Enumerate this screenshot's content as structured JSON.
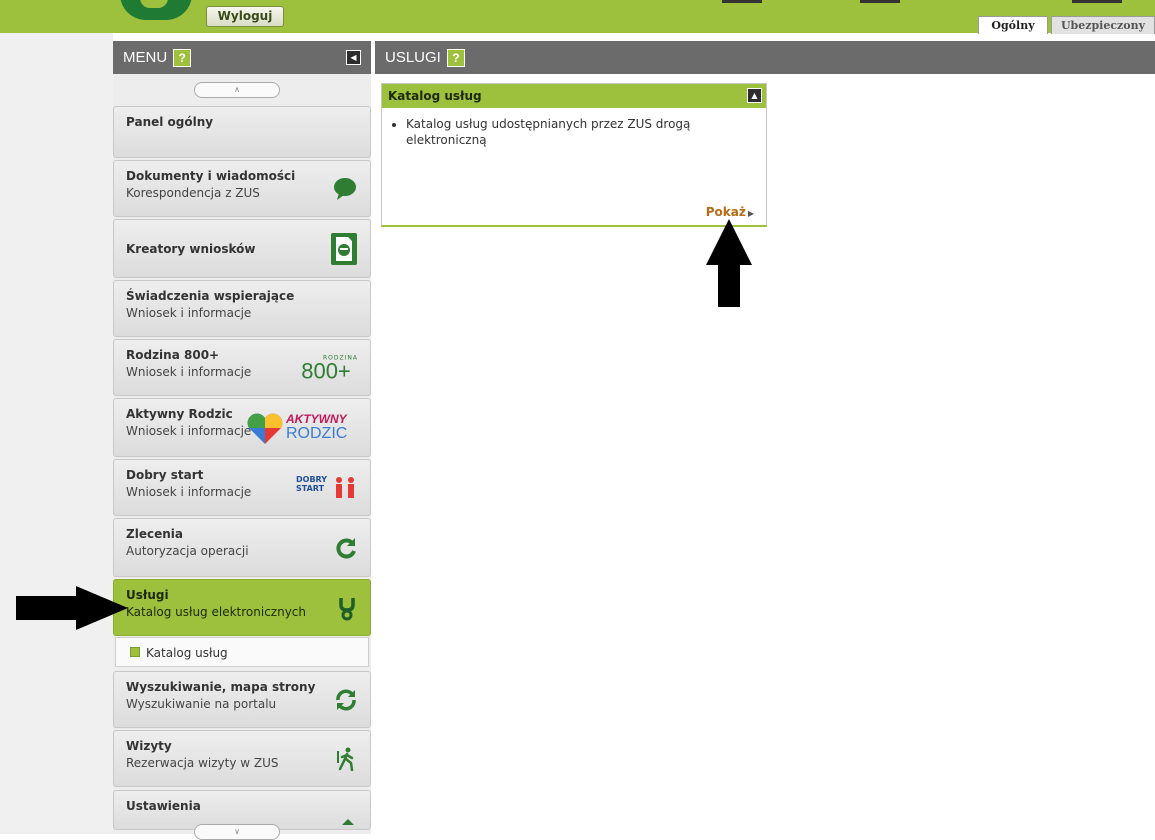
{
  "header": {
    "logout_label": "Wyloguj",
    "tabs": [
      {
        "label": "Ogólny",
        "active": true
      },
      {
        "label": "Ubezpieczony",
        "active": false
      }
    ]
  },
  "menu": {
    "title": "MENU",
    "help": "?",
    "items": [
      {
        "title": "Panel ogólny",
        "subtitle": "",
        "icon": "none"
      },
      {
        "title": "Dokumenty i wiadomości",
        "subtitle": "Korespondencja z ZUS",
        "icon": "speech-bubble-icon"
      },
      {
        "title": "Kreatory wniosków",
        "subtitle": "",
        "icon": "document-form-icon"
      },
      {
        "title": "Świadczenia wspierające",
        "subtitle": "Wniosek i informacje",
        "icon": "none"
      },
      {
        "title": "Rodzina 800+",
        "subtitle": "Wniosek i informacje",
        "icon": "rodzina-800-logo",
        "logo_top": "RODZINA",
        "logo_main": "800+"
      },
      {
        "title": "Aktywny Rodzic",
        "subtitle": "Wniosek i informacje",
        "icon": "aktywny-rodzic-logo",
        "logo_top": "AKTYWNY",
        "logo_main": "RODZIC"
      },
      {
        "title": "Dobry start",
        "subtitle": "Wniosek i informacje",
        "icon": "dobry-start-logo",
        "logo_top": "DOBRY",
        "logo_main": "START"
      },
      {
        "title": "Zlecenia",
        "subtitle": "Autoryzacja operacji",
        "icon": "refresh-icon"
      },
      {
        "title": "Usługi",
        "subtitle": "Katalog usług elektronicznych",
        "icon": "fork-icon",
        "active": true
      },
      {
        "title": "Wyszukiwanie, mapa strony",
        "subtitle": "Wyszukiwanie na portalu",
        "icon": "sync-icon"
      },
      {
        "title": "Wizyty",
        "subtitle": "Rezerwacja wizyty w ZUS",
        "icon": "walking-person-icon"
      },
      {
        "title": "Ustawienia",
        "subtitle": "",
        "icon": "settings-icon"
      }
    ],
    "submenu": [
      "Katalog usług"
    ]
  },
  "main": {
    "title": "USLUGI",
    "help": "?",
    "card": {
      "title": "Katalog usług",
      "bullet": "Katalog usług udostępnianych przez ZUS drogą elektroniczną",
      "link": "Pokaż"
    }
  },
  "colors": {
    "brand_green": "#9dc13d",
    "dark_green": "#1f7a34",
    "header_gray": "#6b6b6b",
    "link_orange": "#b86a14"
  }
}
